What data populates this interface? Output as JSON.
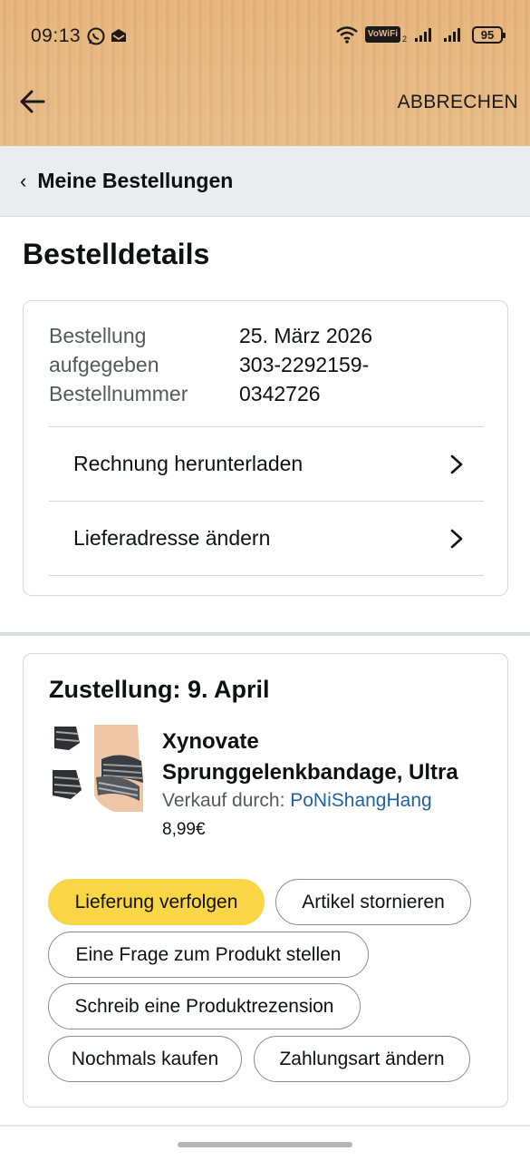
{
  "status_bar": {
    "time": "09:13",
    "left_icons": [
      "whatsapp-icon",
      "notification-icon"
    ],
    "vowifi": "VoWiFi",
    "vowifi_sub": "2",
    "battery": "95"
  },
  "header": {
    "cancel_label": "ABBRECHEN"
  },
  "breadcrumb": {
    "label": "Meine Bestellungen"
  },
  "page": {
    "title": "Bestelldetails"
  },
  "order_info": {
    "date_label_1": "Bestellung",
    "date_label_2": "aufgegeben",
    "date_value": "25. März 2026",
    "number_label": "Bestellnummer",
    "number_value_1": "303-2292159-",
    "number_value_2": "0342726",
    "invoice_label": "Rechnung herunterladen",
    "address_label": "Lieferadresse ändern"
  },
  "delivery": {
    "title": "Zustellung: 9. April",
    "product_title_1": "Xynovate",
    "product_title_2": "Sprunggelenkbandage, Ultra",
    "seller_prefix": "Verkauf durch: ",
    "seller_name": "PoNiShangHang",
    "price": "8,99€",
    "actions": {
      "track": "Lieferung verfolgen",
      "cancel_item": "Artikel stornieren",
      "ask_question": "Eine Frage zum Produkt stellen",
      "write_review": "Schreib eine Produktrezension",
      "buy_again": "Nochmals kaufen",
      "change_payment": "Zahlungsart ändern"
    }
  },
  "colors": {
    "header_bg": "#e6b479",
    "primary_button": "#fad646",
    "link": "#2162a1"
  }
}
